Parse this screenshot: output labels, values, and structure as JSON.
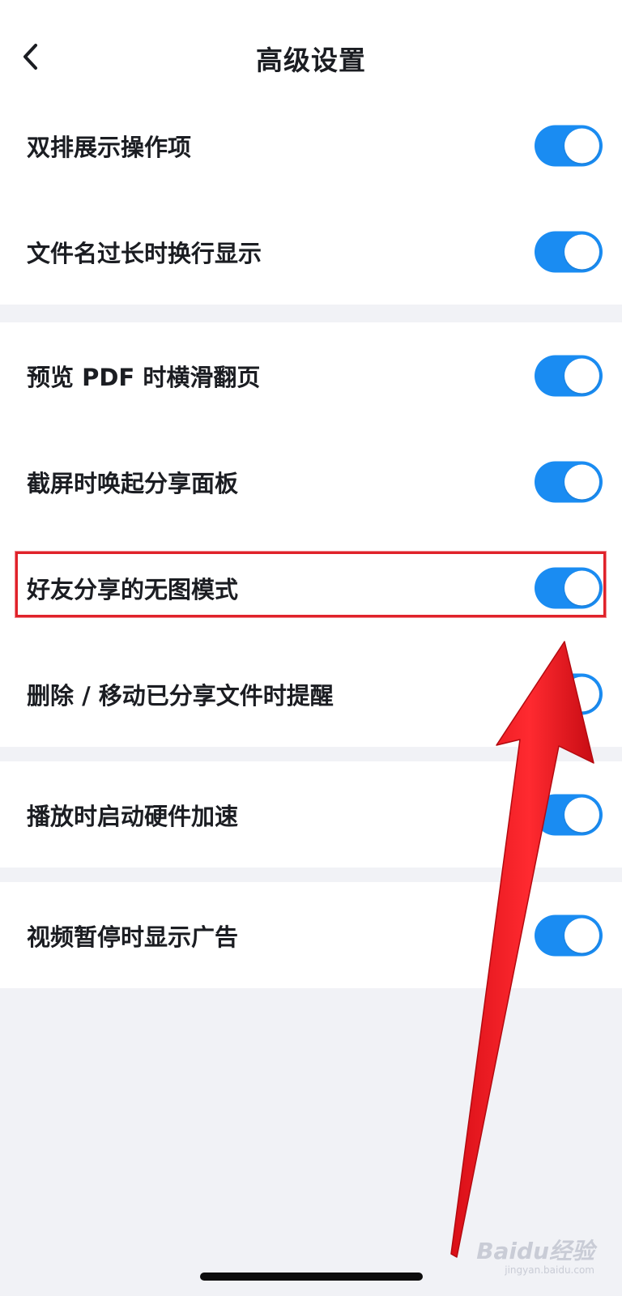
{
  "header": {
    "title": "高级设置",
    "back_icon": "chevron-left-icon"
  },
  "groups": [
    {
      "items": [
        {
          "label": "双排展示操作项",
          "enabled": true
        },
        {
          "label": "文件名过长时换行显示",
          "enabled": true
        }
      ]
    },
    {
      "items": [
        {
          "label": "预览 PDF 时横滑翻页",
          "enabled": true
        },
        {
          "label": "截屏时唤起分享面板",
          "enabled": true
        },
        {
          "label": "好友分享的无图模式",
          "enabled": true
        },
        {
          "label": "删除 / 移动已分享文件时提醒",
          "enabled": true
        }
      ]
    },
    {
      "items": [
        {
          "label": "播放时启动硬件加速",
          "enabled": true
        }
      ]
    },
    {
      "items": [
        {
          "label": "视频暂停时显示广告",
          "enabled": true
        }
      ]
    }
  ],
  "annotation": {
    "highlight_color": "#e0222a",
    "arrow_color": "#ee1c24"
  },
  "colors": {
    "toggle_on": "#1a8cf2",
    "background": "#f1f2f6"
  },
  "watermark": {
    "logo": "Baidu经验",
    "site": "jingyan.baidu.com"
  }
}
